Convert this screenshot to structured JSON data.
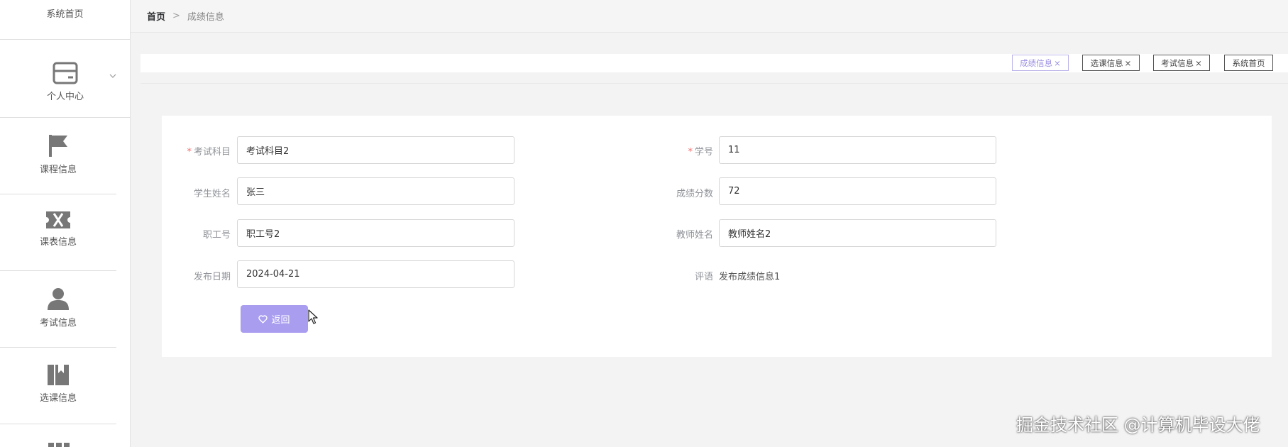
{
  "sidebar": {
    "top_item": "系统首页",
    "items": [
      {
        "label": "个人中心",
        "icon": "card-icon"
      },
      {
        "label": "课程信息",
        "icon": "flag-icon"
      },
      {
        "label": "课表信息",
        "icon": "ticket-icon"
      },
      {
        "label": "考试信息",
        "icon": "user-icon"
      },
      {
        "label": "选课信息",
        "icon": "book-icon"
      }
    ]
  },
  "breadcrumb": {
    "home": "首页",
    "separator": ">",
    "current": "成绩信息"
  },
  "tags": [
    {
      "label": "成绩信息",
      "close": "×"
    },
    {
      "label": "选课信息",
      "close": "×"
    },
    {
      "label": "考试信息",
      "close": "×"
    },
    {
      "label": "系统首页"
    }
  ],
  "form": {
    "required_mark": "*",
    "exam_subject": {
      "label": "考试科目",
      "value": "考试科目2"
    },
    "student_no": {
      "label": "学号",
      "value": "11"
    },
    "student_name": {
      "label": "学生姓名",
      "value": "张三"
    },
    "score": {
      "label": "成绩分数",
      "value": "72"
    },
    "staff_no": {
      "label": "职工号",
      "value": "职工号2"
    },
    "teacher_name": {
      "label": "教师姓名",
      "value": "教师姓名2"
    },
    "publish_date": {
      "label": "发布日期",
      "value": "2024-04-21"
    },
    "comment": {
      "label": "评语",
      "value": "发布成绩信息1"
    }
  },
  "back_button": "返回",
  "watermark": "掘金技术社区 @计算机毕设大佬",
  "colors": {
    "accent": "#a99df0",
    "active_tag": "#9a8ee0",
    "required": "#f56c6c"
  }
}
